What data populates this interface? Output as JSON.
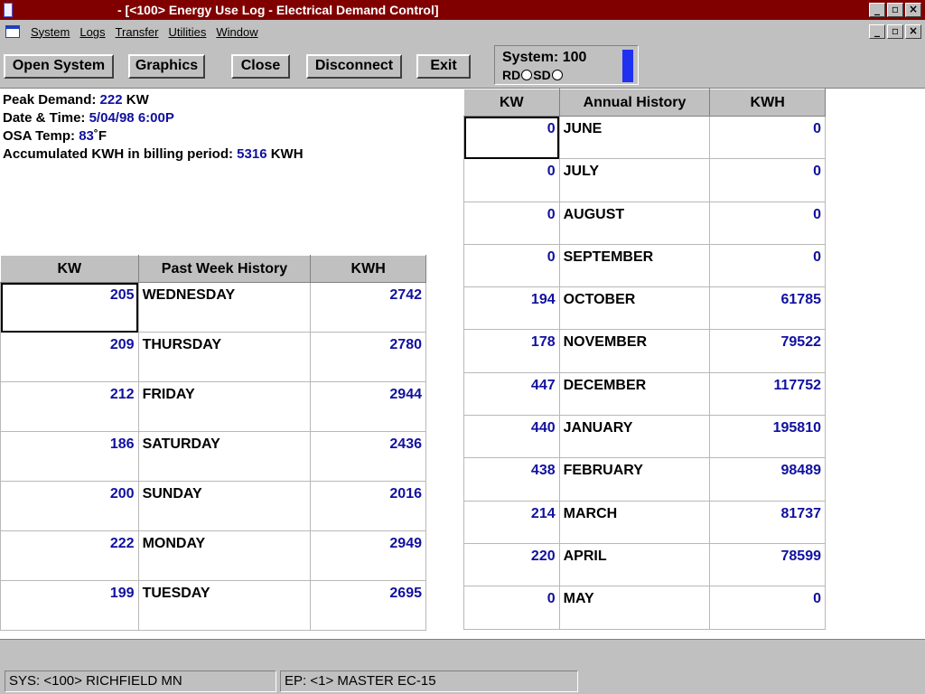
{
  "window": {
    "title": "- [<100> Energy Use Log - Electrical Demand Control]"
  },
  "menu": {
    "items": [
      "System",
      "Logs",
      "Transfer",
      "Utilities",
      "Window"
    ]
  },
  "toolbar": {
    "open_system": "Open System",
    "graphics": "Graphics",
    "close": "Close",
    "disconnect": "Disconnect",
    "exit": "Exit",
    "system_label": "System: 100",
    "rd_label": "RD",
    "sd_label": "SD",
    "indicator_color": "#2030f0"
  },
  "summary": {
    "peak_demand_label": "Peak Demand:",
    "peak_demand_value": "222",
    "peak_demand_unit": "KW",
    "datetime_label": "Date & Time:",
    "date_value": "5/04/98",
    "time_value": "6:00P",
    "osa_label": "OSA Temp:",
    "osa_value": "83",
    "osa_unit": "˚F",
    "accum_label": "Accumulated KWH in billing period:",
    "accum_value": "5316",
    "accum_unit": "KWH"
  },
  "week": {
    "headers": [
      "KW",
      "Past Week History",
      "KWH"
    ],
    "rows": [
      {
        "kw": "205",
        "day": "WEDNESDAY",
        "kwh": "2742"
      },
      {
        "kw": "209",
        "day": "THURSDAY",
        "kwh": "2780"
      },
      {
        "kw": "212",
        "day": "FRIDAY",
        "kwh": "2944"
      },
      {
        "kw": "186",
        "day": "SATURDAY",
        "kwh": "2436"
      },
      {
        "kw": "200",
        "day": "SUNDAY",
        "kwh": "2016"
      },
      {
        "kw": "222",
        "day": "MONDAY",
        "kwh": "2949"
      },
      {
        "kw": "199",
        "day": "TUESDAY",
        "kwh": "2695"
      }
    ]
  },
  "annual": {
    "headers": [
      "KW",
      "Annual History",
      "KWH"
    ],
    "rows": [
      {
        "kw": "0",
        "month": "JUNE",
        "kwh": "0"
      },
      {
        "kw": "0",
        "month": "JULY",
        "kwh": "0"
      },
      {
        "kw": "0",
        "month": "AUGUST",
        "kwh": "0"
      },
      {
        "kw": "0",
        "month": "SEPTEMBER",
        "kwh": "0"
      },
      {
        "kw": "194",
        "month": "OCTOBER",
        "kwh": "61785"
      },
      {
        "kw": "178",
        "month": "NOVEMBER",
        "kwh": "79522"
      },
      {
        "kw": "447",
        "month": "DECEMBER",
        "kwh": "117752"
      },
      {
        "kw": "440",
        "month": "JANUARY",
        "kwh": "195810"
      },
      {
        "kw": "438",
        "month": "FEBRUARY",
        "kwh": "98489"
      },
      {
        "kw": "214",
        "month": "MARCH",
        "kwh": "81737"
      },
      {
        "kw": "220",
        "month": "APRIL",
        "kwh": "78599"
      },
      {
        "kw": "0",
        "month": "MAY",
        "kwh": "0"
      }
    ]
  },
  "status": {
    "sys": "SYS: <100> RICHFIELD MN",
    "ep": "EP: <1> MASTER EC-15"
  }
}
